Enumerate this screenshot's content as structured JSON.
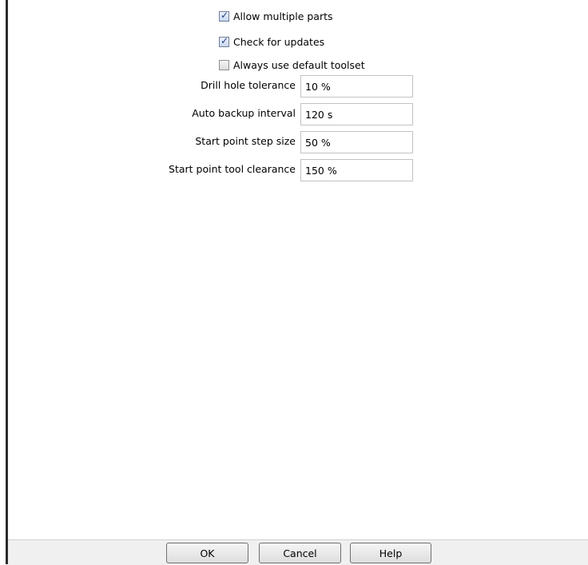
{
  "checkboxes": [
    {
      "label": "Allow multiple parts",
      "checked": true
    },
    {
      "label": "Check for updates",
      "checked": true
    },
    {
      "label": "Always use default toolset",
      "checked": false
    }
  ],
  "fields": [
    {
      "label": "Drill hole tolerance",
      "value": "10 %"
    },
    {
      "label": "Auto backup interval",
      "value": "120 s"
    },
    {
      "label": "Start point step size",
      "value": "50 %"
    },
    {
      "label": "Start point tool clearance",
      "value": "150 %"
    }
  ],
  "buttons": {
    "ok": "OK",
    "cancel": "Cancel",
    "help": "Help"
  },
  "check_glyph": "✓"
}
